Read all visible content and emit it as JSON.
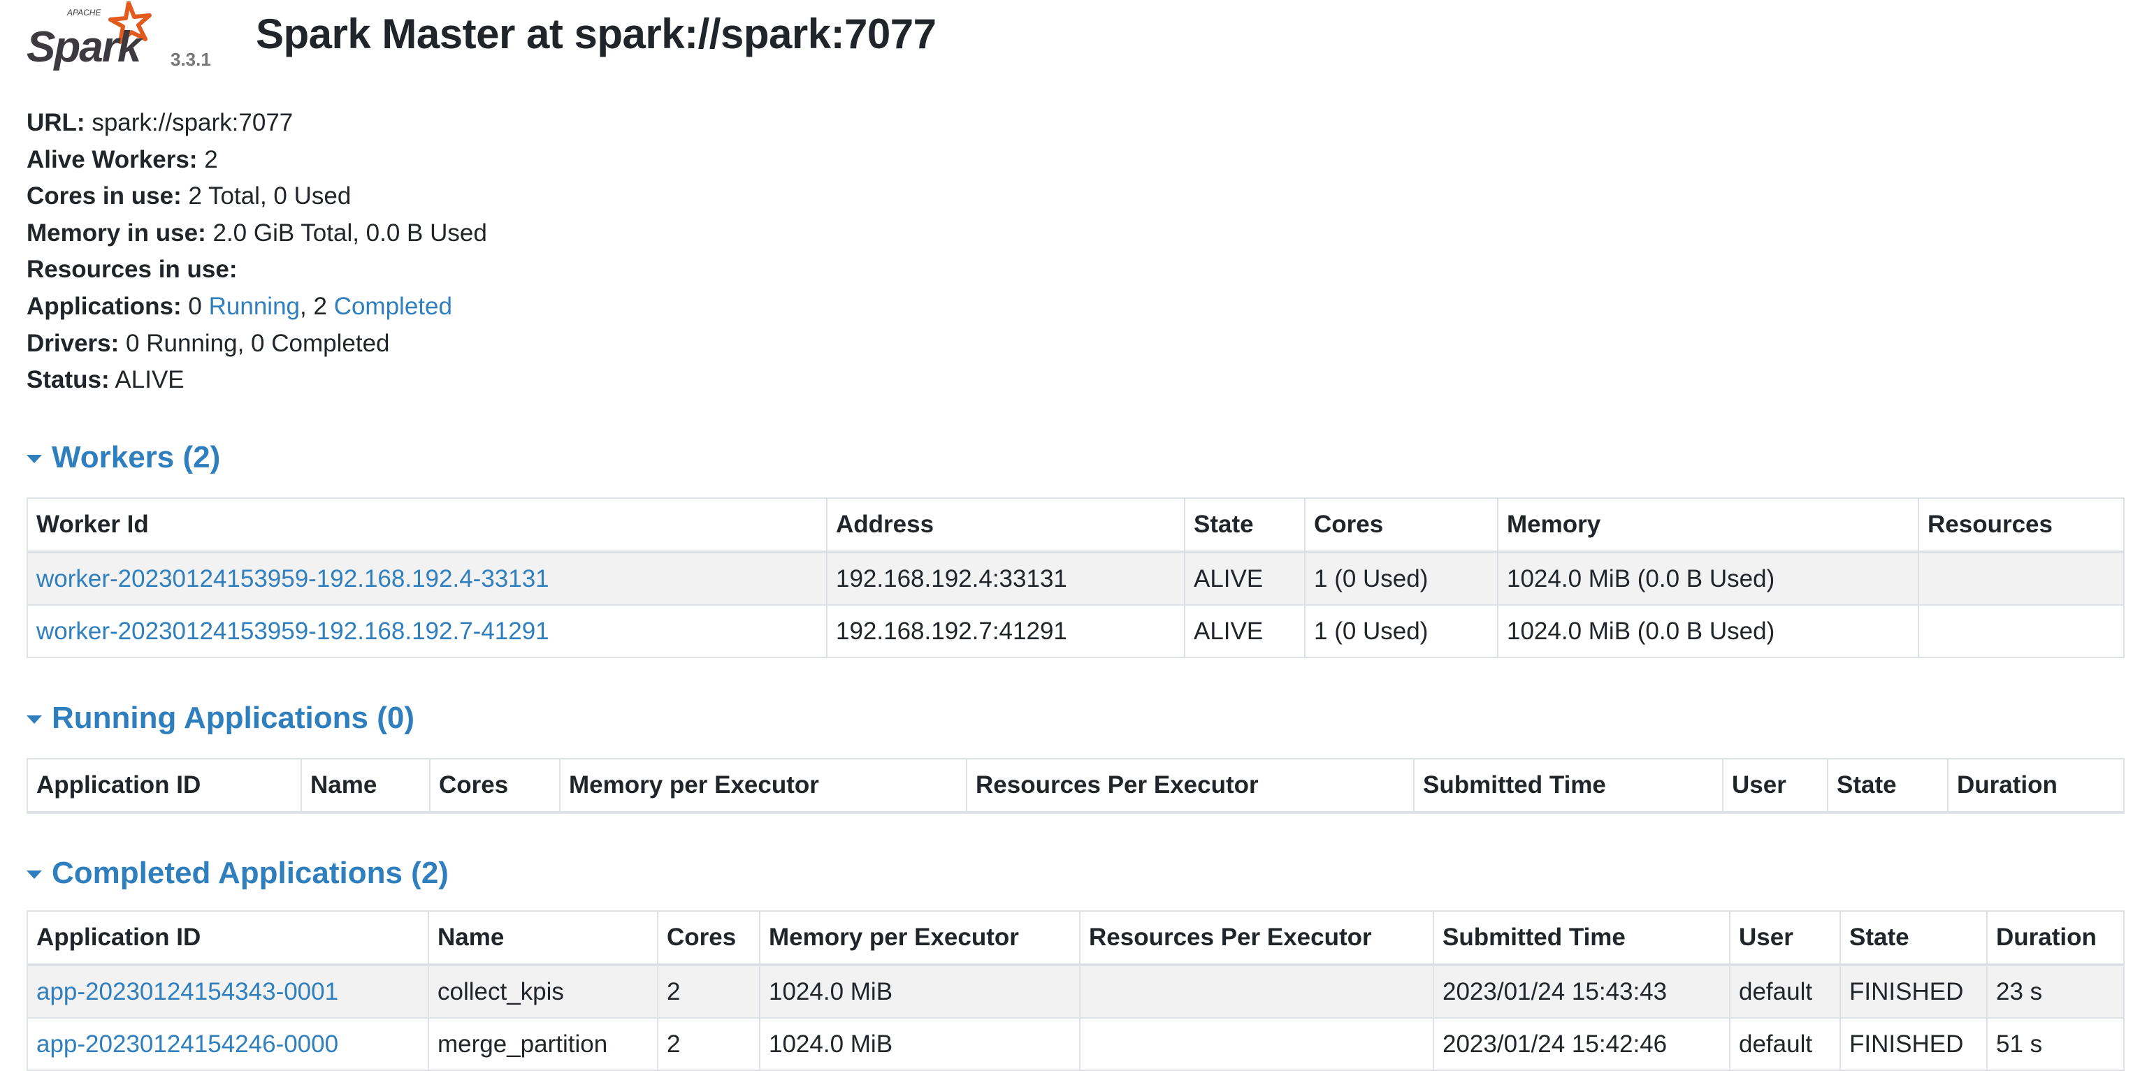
{
  "header": {
    "logo_text": "Spark",
    "logo_apache": "APACHE",
    "version": "3.3.1",
    "title": "Spark Master at spark://spark:7077"
  },
  "summary": {
    "url_label": "URL:",
    "url_value": "spark://spark:7077",
    "alive_workers_label": "Alive Workers:",
    "alive_workers_value": "2",
    "cores_label": "Cores in use:",
    "cores_value": "2 Total, 0 Used",
    "memory_label": "Memory in use:",
    "memory_value": "2.0 GiB Total, 0.0 B Used",
    "resources_label": "Resources in use:",
    "applications_label": "Applications:",
    "applications_running_count": "0",
    "applications_running_link": "Running",
    "applications_separator": ",",
    "applications_completed_count": "2",
    "applications_completed_link": "Completed",
    "drivers_label": "Drivers:",
    "drivers_value": "0 Running, 0 Completed",
    "status_label": "Status:",
    "status_value": "ALIVE"
  },
  "workers": {
    "title": "Workers (2)",
    "columns": [
      "Worker Id",
      "Address",
      "State",
      "Cores",
      "Memory",
      "Resources"
    ],
    "rows": [
      {
        "id": "worker-20230124153959-192.168.192.4-33131",
        "address": "192.168.192.4:33131",
        "state": "ALIVE",
        "cores": "1 (0 Used)",
        "memory": "1024.0 MiB (0.0 B Used)",
        "resources": ""
      },
      {
        "id": "worker-20230124153959-192.168.192.7-41291",
        "address": "192.168.192.7:41291",
        "state": "ALIVE",
        "cores": "1 (0 Used)",
        "memory": "1024.0 MiB (0.0 B Used)",
        "resources": ""
      }
    ]
  },
  "running_apps": {
    "title": "Running Applications (0)",
    "columns": [
      "Application ID",
      "Name",
      "Cores",
      "Memory per Executor",
      "Resources Per Executor",
      "Submitted Time",
      "User",
      "State",
      "Duration"
    ]
  },
  "completed_apps": {
    "title": "Completed Applications (2)",
    "columns": [
      "Application ID",
      "Name",
      "Cores",
      "Memory per Executor",
      "Resources Per Executor",
      "Submitted Time",
      "User",
      "State",
      "Duration"
    ],
    "rows": [
      {
        "id": "app-20230124154343-0001",
        "name": "collect_kpis",
        "cores": "2",
        "memory": "1024.0 MiB",
        "resources": "",
        "submitted": "2023/01/24 15:43:43",
        "user": "default",
        "state": "FINISHED",
        "duration": "23 s"
      },
      {
        "id": "app-20230124154246-0000",
        "name": "merge_partition",
        "cores": "2",
        "memory": "1024.0 MiB",
        "resources": "",
        "submitted": "2023/01/24 15:42:46",
        "user": "default",
        "state": "FINISHED",
        "duration": "51 s"
      }
    ]
  },
  "colors": {
    "link": "#2f7fbf",
    "logo_orange": "#e25a1c",
    "logo_text": "#3c3a3e"
  }
}
